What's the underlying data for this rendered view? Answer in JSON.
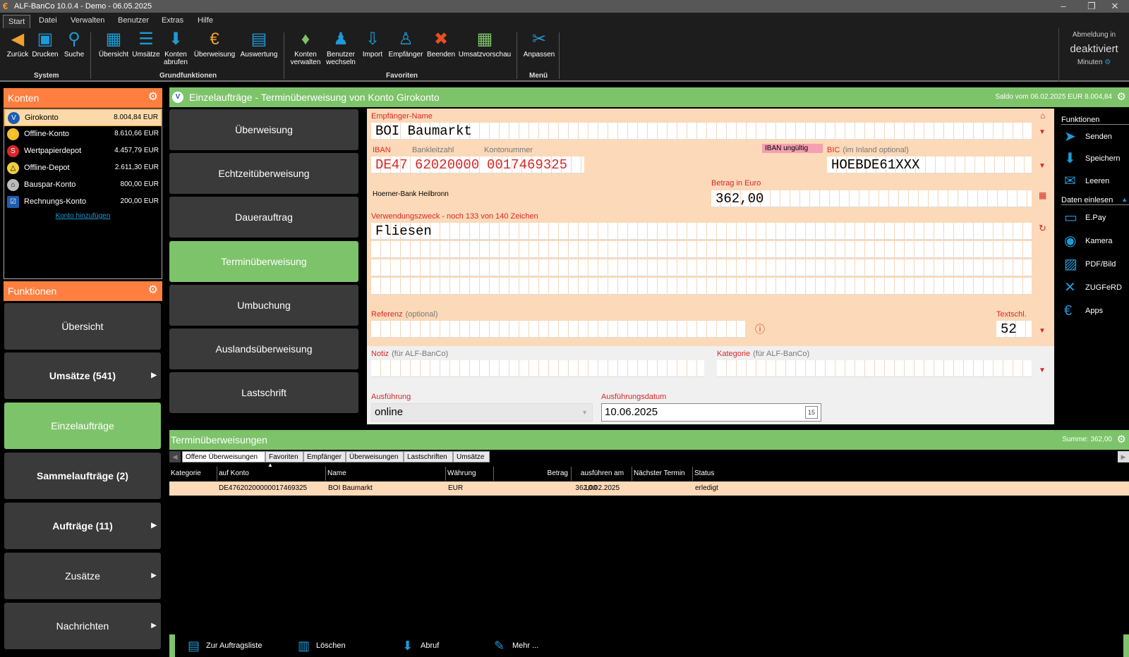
{
  "window": {
    "title": "ALF-BanCo 10.0.4 - Demo  -  06.05.2025",
    "minimize": "–",
    "restore": "❐",
    "close": "✕"
  },
  "menu": [
    "Start",
    "Datei",
    "Verwalten",
    "Benutzer",
    "Extras",
    "Hilfe"
  ],
  "ribbon": {
    "buttons": [
      {
        "label": "Zurück",
        "icon": "back-arrow-icon",
        "glyph": "◀",
        "color": "#f0a030"
      },
      {
        "label": "Drucken",
        "icon": "printer-icon",
        "glyph": "🖶",
        "color": "#1e9ad6"
      },
      {
        "label": "Suche",
        "icon": "search-icon",
        "glyph": "🔍",
        "color": "#1e9ad6"
      },
      {
        "label": "Übersicht",
        "icon": "overview-icon",
        "glyph": "▦",
        "color": "#1e9ad6"
      },
      {
        "label": "Umsätze",
        "icon": "list-icon",
        "glyph": "☰",
        "color": "#1e9ad6"
      },
      {
        "label": "Konten abrufen",
        "icon": "download-icon",
        "glyph": "⬇",
        "color": "#1e9ad6"
      },
      {
        "label": "Überweisung",
        "icon": "euro-icon",
        "glyph": "€",
        "color": "#f0a030"
      },
      {
        "label": "Auswertung",
        "icon": "document-icon",
        "glyph": "▤",
        "color": "#1e9ad6"
      },
      {
        "label": "Konten verwalten",
        "icon": "money-bag-icon",
        "glyph": "💰",
        "color": "#7dc36a"
      },
      {
        "label": "Benutzer wechseln",
        "icon": "users-icon",
        "glyph": "👥",
        "color": "#1e9ad6"
      },
      {
        "label": "Import",
        "icon": "import-icon",
        "glyph": "⇩",
        "color": "#1e9ad6"
      },
      {
        "label": "Empfänger",
        "icon": "recipient-icon",
        "glyph": "👤",
        "color": "#1e9ad6"
      },
      {
        "label": "Beenden",
        "icon": "exit-icon",
        "glyph": "✖",
        "color": "#e85020"
      },
      {
        "label": "Umsatzvorschau",
        "icon": "preview-icon",
        "glyph": "▦",
        "color": "#7dc36a"
      },
      {
        "label": "Anpassen",
        "icon": "tools-icon",
        "glyph": "✂",
        "color": "#1e9ad6"
      }
    ],
    "groups": [
      "System",
      "Grundfunktionen",
      "Favoriten",
      "Menü"
    ],
    "login": {
      "line1": "Abmeldung in",
      "line2": "deaktiviert",
      "line3": "Minuten"
    }
  },
  "konten": {
    "title": "Konten",
    "items": [
      {
        "name": "Girokonto",
        "value": "8.004,84 EUR",
        "icon": "vr-bank-icon",
        "glyph": "V"
      },
      {
        "name": "Offline-Konto",
        "value": "8.610,66 EUR",
        "icon": "offline-account-icon",
        "glyph": "⚡"
      },
      {
        "name": "Wertpapierdepot",
        "value": "4.457,79 EUR",
        "icon": "sparkasse-icon",
        "glyph": "S"
      },
      {
        "name": "Offline-Depot",
        "value": "2.611,30 EUR",
        "icon": "depot-icon",
        "glyph": "△"
      },
      {
        "name": "Bauspar-Konto",
        "value": "800,00 EUR",
        "icon": "bank-building-icon",
        "glyph": "🏛"
      },
      {
        "name": "Rechnungs-Konto",
        "value": "200,00 EUR",
        "icon": "invoice-icon",
        "glyph": "☑"
      }
    ],
    "add_link": "Konto hinzufügen"
  },
  "funktionen": {
    "title": "Funktionen",
    "items": [
      {
        "label": "Übersicht",
        "bold": false,
        "arrow": ""
      },
      {
        "label": "Umsätze (541)",
        "bold": true,
        "arrow": "▶"
      },
      {
        "label": "Einzelaufträge",
        "bold": false,
        "arrow": ""
      },
      {
        "label": "Sammelaufträge (2)",
        "bold": true,
        "arrow": ""
      },
      {
        "label": "Aufträge (11)",
        "bold": true,
        "arrow": "▶"
      },
      {
        "label": "Zusätze",
        "bold": false,
        "arrow": "▶"
      },
      {
        "label": "Nachrichten",
        "bold": false,
        "arrow": "▶"
      }
    ]
  },
  "main": {
    "title": "Einzelaufträge - Terminüberweisung von Konto Girokonto",
    "saldo": "Saldo vom 06.02.2025 EUR 8.004,84",
    "types": [
      "Überweisung",
      "Echtzeitüberweisung",
      "Dauerauftrag",
      "Terminüberweisung",
      "Umbuchung",
      "Auslandsüberweisung",
      "Lastschrift"
    ]
  },
  "form": {
    "empfaenger_label": "Empfänger-Name",
    "empfaenger": "BOI Baumarkt",
    "iban_label": "IBAN",
    "blz_label": "Bankleitzahl",
    "kto_label": "Kontonummer",
    "iban_cc": "DE47",
    "iban_blz": "62020000",
    "iban_kto": "0017469325",
    "iban_warning": "IBAN ungültig",
    "bic_label": "BIC",
    "bic_opt": "(im Inland optional)",
    "bic": "HOEBDE61XXX",
    "bank_name": "Hoerner-Bank Heilbronn",
    "betrag_label": "Betrag in Euro",
    "betrag": "362,00",
    "zweck_label": "Verwendungszweck - noch 133 von 140 Zeichen",
    "zweck": "Fliesen",
    "referenz_label": "Referenz",
    "referenz_opt": "(optional)",
    "textschl_label": "Textschl.",
    "textschl": "52",
    "notiz_label": "Notiz",
    "notiz_opt": "(für ALF-BanCo)",
    "kategorie_label": "Kategorie",
    "kategorie_opt": "(für ALF-BanCo)",
    "ausfuehrung_label": "Ausführung",
    "ausfuehrung": "online",
    "datum_label": "Ausführungsdatum",
    "datum": "10.06.2025"
  },
  "right": {
    "funktionen_title": "Funktionen",
    "funktionen": [
      {
        "label": "Senden",
        "icon": "send-icon",
        "glyph": "➤"
      },
      {
        "label": "Speichern",
        "icon": "save-icon",
        "glyph": "⬇"
      },
      {
        "label": "Leeren",
        "icon": "clear-icon",
        "glyph": "✉"
      }
    ],
    "einlesen_title": "Daten einlesen",
    "einlesen": [
      {
        "label": "E.Pay",
        "icon": "epay-icon",
        "glyph": "▭"
      },
      {
        "label": "Kamera",
        "icon": "camera-icon",
        "glyph": "◉"
      },
      {
        "label": "PDF/Bild",
        "icon": "pdf-icon",
        "glyph": "▨"
      },
      {
        "label": "ZUGFeRD",
        "icon": "zugferd-icon",
        "glyph": "✕"
      },
      {
        "label": "Apps",
        "icon": "apps-icon",
        "glyph": "€"
      }
    ]
  },
  "list": {
    "title": "Terminüberweisungen",
    "summe": "Summe: 362,00",
    "tabs": [
      "Offene Überweisungen",
      "Favoriten",
      "Empfänger",
      "Überweisungen",
      "Lastschriften",
      "Umsätze"
    ],
    "columns": [
      "Kategorie",
      "auf Konto",
      "Name",
      "Währung",
      "Betrag",
      "ausführen am",
      "Nächster Termin",
      "Status"
    ],
    "rows": [
      {
        "kategorie": "",
        "konto": "DE47620200000017469325",
        "name": "BOI Baumarkt",
        "waehrung": "EUR",
        "betrag": "362,00",
        "datum": "10.02.2025",
        "termin": "",
        "status": "erledigt"
      }
    ]
  },
  "bottom": [
    {
      "label": "Zur Auftragsliste",
      "icon": "document-list-icon",
      "glyph": "▤"
    },
    {
      "label": "Löschen",
      "icon": "trash-icon",
      "glyph": "🗑"
    },
    {
      "label": "Abruf",
      "icon": "download-icon",
      "glyph": "⬇"
    },
    {
      "label": "Mehr ...",
      "icon": "pen-icon",
      "glyph": "✎"
    }
  ],
  "colors": {
    "orange": "#ff7f40",
    "green": "#7dc36a",
    "blue": "#1e9ad6",
    "red": "#d62828",
    "form_bg": "#fcd9b8"
  }
}
